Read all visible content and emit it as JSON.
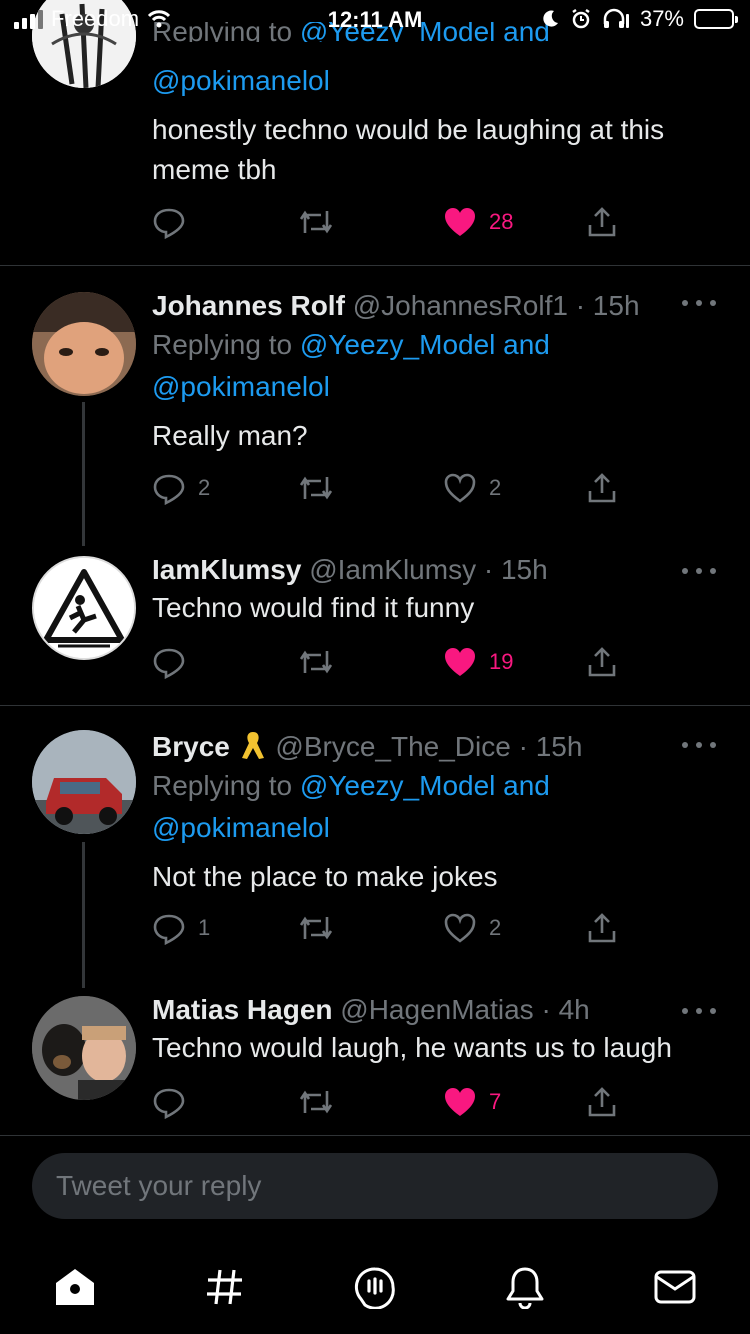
{
  "status_bar": {
    "carrier": "Freedom",
    "time": "12:11 AM",
    "battery": "37%"
  },
  "tweets": [
    {
      "reply_prefix": "Replying to",
      "mentions": "@Yeezy_Model and",
      "mention2": "@pokimanelol",
      "text": "honestly techno would be laughing at this meme tbh",
      "likes": "28",
      "liked": true
    },
    {
      "name": "Johannes Rolf",
      "handle": "@JohannesRolf1 · 15h",
      "reply_prefix": "Replying to",
      "mentions": "@Yeezy_Model and",
      "mention2": "@pokimanelol",
      "text": "Really man?",
      "replies": "2",
      "likes": "2",
      "liked": false
    },
    {
      "name": "IamKlumsy",
      "handle": "@IamKlumsy · 15h",
      "text": "Techno would find it funny",
      "likes": "19",
      "liked": true
    },
    {
      "name": "Bryce",
      "handle": "@Bryce_The_Dice · 15h",
      "reply_prefix": "Replying to",
      "mentions": "@Yeezy_Model and",
      "mention2": "@pokimanelol",
      "text": "Not the place to make jokes",
      "replies": "1",
      "likes": "2",
      "liked": false
    },
    {
      "name": "Matias Hagen",
      "handle": "@HagenMatias · 4h",
      "text": "Techno would laugh, he wants us to laugh",
      "likes": "7",
      "liked": true
    }
  ],
  "compose": {
    "placeholder": "Tweet your reply"
  },
  "tabs": [
    "home-icon",
    "explore-hashtag-icon",
    "spaces-icon",
    "notifications-bell-icon",
    "messages-envelope-icon"
  ],
  "colors": {
    "like": "#f91880",
    "mention": "#1d9bf0",
    "muted": "#71767b"
  }
}
